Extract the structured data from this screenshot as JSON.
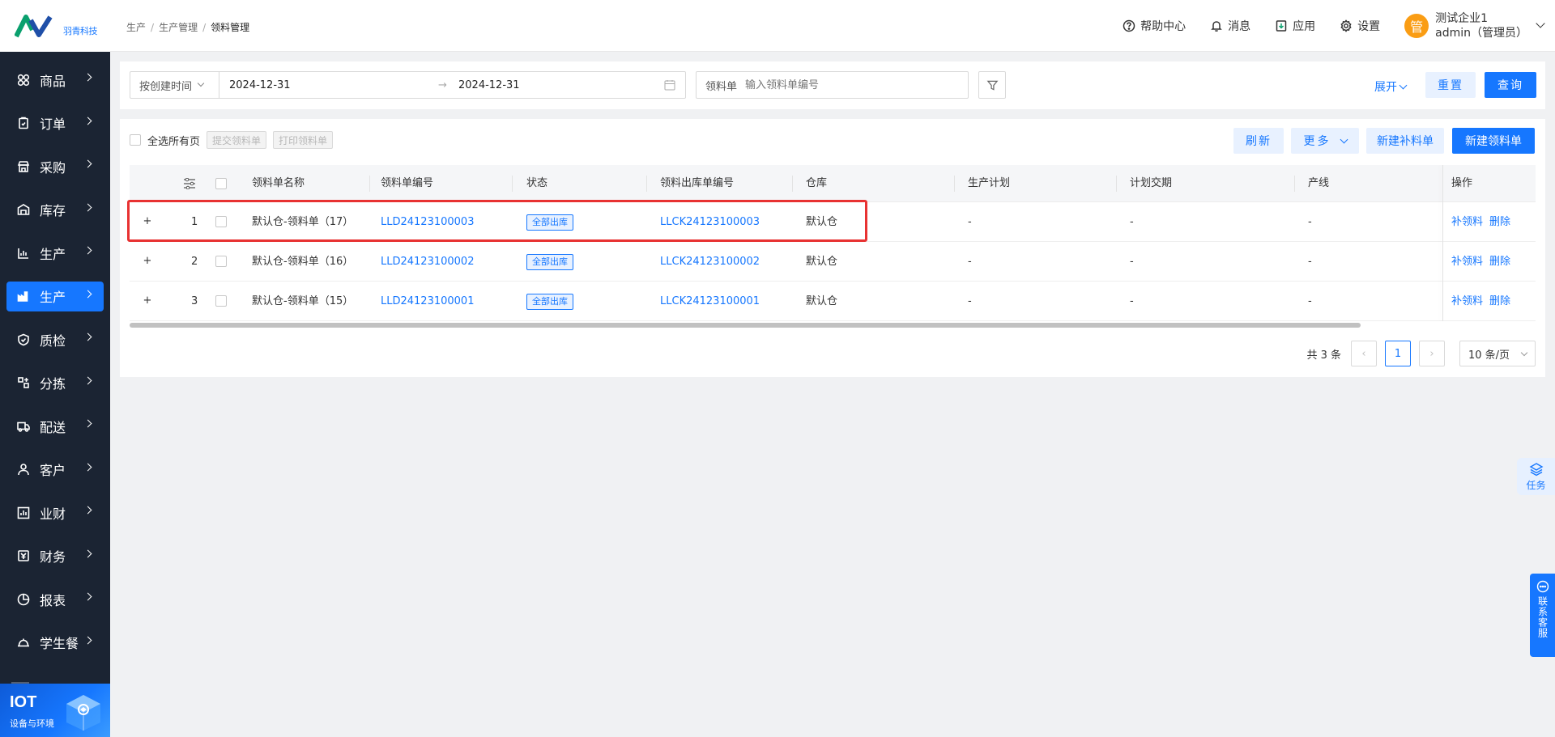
{
  "brand": {
    "logo_text": "羽青科技"
  },
  "sidebar": {
    "items": [
      {
        "label": "商品",
        "icon": "grid-icon",
        "active": false
      },
      {
        "label": "订单",
        "icon": "clipboard-icon",
        "active": false
      },
      {
        "label": "采购",
        "icon": "shop-icon",
        "active": false
      },
      {
        "label": "库存",
        "icon": "warehouse-icon",
        "active": false
      },
      {
        "label": "生产",
        "icon": "chart-icon",
        "active": false
      },
      {
        "label": "生产",
        "icon": "factory-icon",
        "active": true
      },
      {
        "label": "质检",
        "icon": "shield-icon",
        "active": false
      },
      {
        "label": "分拣",
        "icon": "sort-icon",
        "active": false
      },
      {
        "label": "配送",
        "icon": "truck-icon",
        "active": false
      },
      {
        "label": "客户",
        "icon": "user-icon",
        "active": false
      },
      {
        "label": "业财",
        "icon": "bar-chart-icon",
        "active": false
      },
      {
        "label": "财务",
        "icon": "wallet-icon",
        "active": false
      },
      {
        "label": "报表",
        "icon": "pie-icon",
        "active": false
      },
      {
        "label": "学生餐",
        "icon": "meal-icon",
        "active": false
      }
    ],
    "iot": {
      "title": "IOT",
      "subtitle": "设备与环境"
    }
  },
  "header": {
    "breadcrumb": [
      "生产",
      "生产管理",
      "领料管理"
    ],
    "help": "帮助中心",
    "messages": "消息",
    "apps": "应用",
    "settings": "设置",
    "user": {
      "avatar": "管",
      "company": "测试企业1",
      "name": "admin（管理员）"
    }
  },
  "filter": {
    "date_type": "按创建时间",
    "date_start": "2024-12-31",
    "date_end": "2024-12-31",
    "arrow": "→",
    "search_label": "领料单",
    "search_placeholder": "输入领料单编号",
    "expand": "展开",
    "reset": "重置",
    "query": "查询"
  },
  "toolbar": {
    "select_all": "全选所有页",
    "submit": "提交领料单",
    "print": "打印领料单",
    "refresh": "刷新",
    "more": "更多",
    "new_supplement": "新建补料单",
    "new_requisition": "新建领料单"
  },
  "table": {
    "columns": [
      "领料单名称",
      "领料单编号",
      "状态",
      "领料出库单编号",
      "仓库",
      "生产计划",
      "计划交期",
      "产线",
      "操作"
    ],
    "rows": [
      {
        "idx": "1",
        "name": "默认仓-领料单（17）",
        "code": "LLD24123100003",
        "status": "全部出库",
        "out_code": "LLCK24123100003",
        "warehouse": "默认仓",
        "plan": "-",
        "due": "-",
        "line": "-",
        "op1": "补领料",
        "op2": "删除"
      },
      {
        "idx": "2",
        "name": "默认仓-领料单（16）",
        "code": "LLD24123100002",
        "status": "全部出库",
        "out_code": "LLCK24123100002",
        "warehouse": "默认仓",
        "plan": "-",
        "due": "-",
        "line": "-",
        "op1": "补领料",
        "op2": "删除"
      },
      {
        "idx": "3",
        "name": "默认仓-领料单（15）",
        "code": "LLD24123100001",
        "status": "全部出库",
        "out_code": "LLCK24123100001",
        "warehouse": "默认仓",
        "plan": "-",
        "due": "-",
        "line": "-",
        "op1": "补领料",
        "op2": "删除"
      }
    ]
  },
  "pagination": {
    "total": "共 3 条",
    "current": "1",
    "page_size": "10 条/页"
  },
  "floats": {
    "task": "任务",
    "customer_service": "联系客服"
  },
  "colors": {
    "primary": "#1677ff",
    "sidebar_bg": "#1b2433",
    "highlight": "#e83232",
    "avatar": "#fa9d14"
  }
}
